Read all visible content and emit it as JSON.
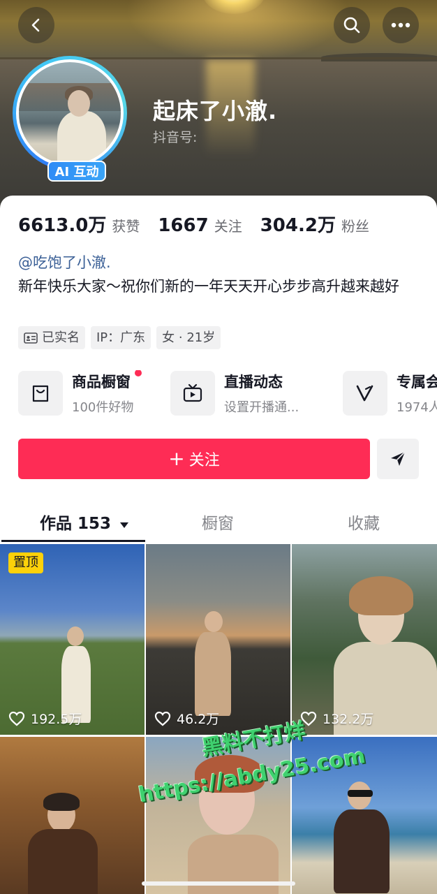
{
  "profile": {
    "nickname": "起床了小澈.",
    "douyin_id_label": "抖音号:",
    "ai_badge": "AI 互动"
  },
  "stats": {
    "likes_value": "6613.0万",
    "likes_label": "获赞",
    "following_value": "1667",
    "following_label": "关注",
    "followers_value": "304.2万",
    "followers_label": "粉丝"
  },
  "bio": {
    "mention": "@吃饱了小澈.",
    "text": "新年快乐大家～祝你们新的一年天天开心步步高升越来越好"
  },
  "tags": {
    "verified": "已实名",
    "ip": "IP：广东",
    "gender_age": "女 · 21岁"
  },
  "services": [
    {
      "title": "商品橱窗",
      "subtitle": "100件好物",
      "icon": "bag-icon",
      "has_dot": true
    },
    {
      "title": "直播动态",
      "subtitle": "设置开播通...",
      "icon": "tv-icon",
      "has_dot": false
    },
    {
      "title": "专属会",
      "subtitle": "1974人",
      "icon": "v-icon",
      "has_dot": false
    }
  ],
  "actions": {
    "follow_label": "关注",
    "follow_color": "#fe2c55"
  },
  "tabs": {
    "works_label": "作品",
    "works_count": "153",
    "showcase_label": "橱窗",
    "favorites_label": "收藏"
  },
  "videos": [
    {
      "pinned_label": "置顶",
      "likes": "192.5万"
    },
    {
      "likes": "46.2万"
    },
    {
      "likes": "132.2万"
    },
    {
      "likes": ""
    },
    {
      "likes": ""
    },
    {
      "likes": ""
    }
  ],
  "watermark": {
    "line1": "黑料不打烊",
    "line2": "https://abdy25.com"
  }
}
